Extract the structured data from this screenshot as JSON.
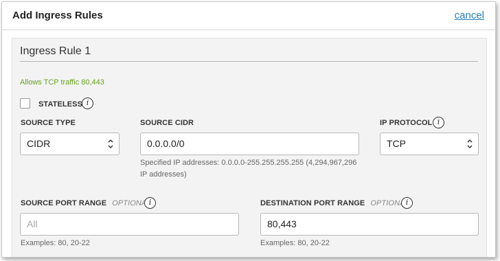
{
  "dialog": {
    "title": "Add Ingress Rules",
    "cancel_label": "cancel"
  },
  "rule": {
    "title": "Ingress Rule 1",
    "description": "Allows TCP traffic 80,443",
    "stateless_label": "STATELESS",
    "source_type": {
      "label": "SOURCE TYPE",
      "value": "CIDR"
    },
    "source_cidr": {
      "label": "SOURCE CIDR",
      "value": "0.0.0.0/0",
      "help_line1": "Specified IP addresses: 0.0.0.0-255.255.255.255 (4,294,967,296",
      "help_line2": "IP addresses)"
    },
    "ip_protocol": {
      "label": "IP PROTOCOL",
      "value": "TCP"
    },
    "source_port_range": {
      "label": "SOURCE PORT RANGE",
      "optional": "OPTIONAL",
      "placeholder": "All",
      "help": "Examples: 80, 20-22"
    },
    "destination_port_range": {
      "label": "DESTINATION PORT RANGE",
      "optional": "OPTIONAL",
      "value": "80,443",
      "help": "Examples: 80, 20-22"
    }
  },
  "icons": {
    "info": "i"
  }
}
